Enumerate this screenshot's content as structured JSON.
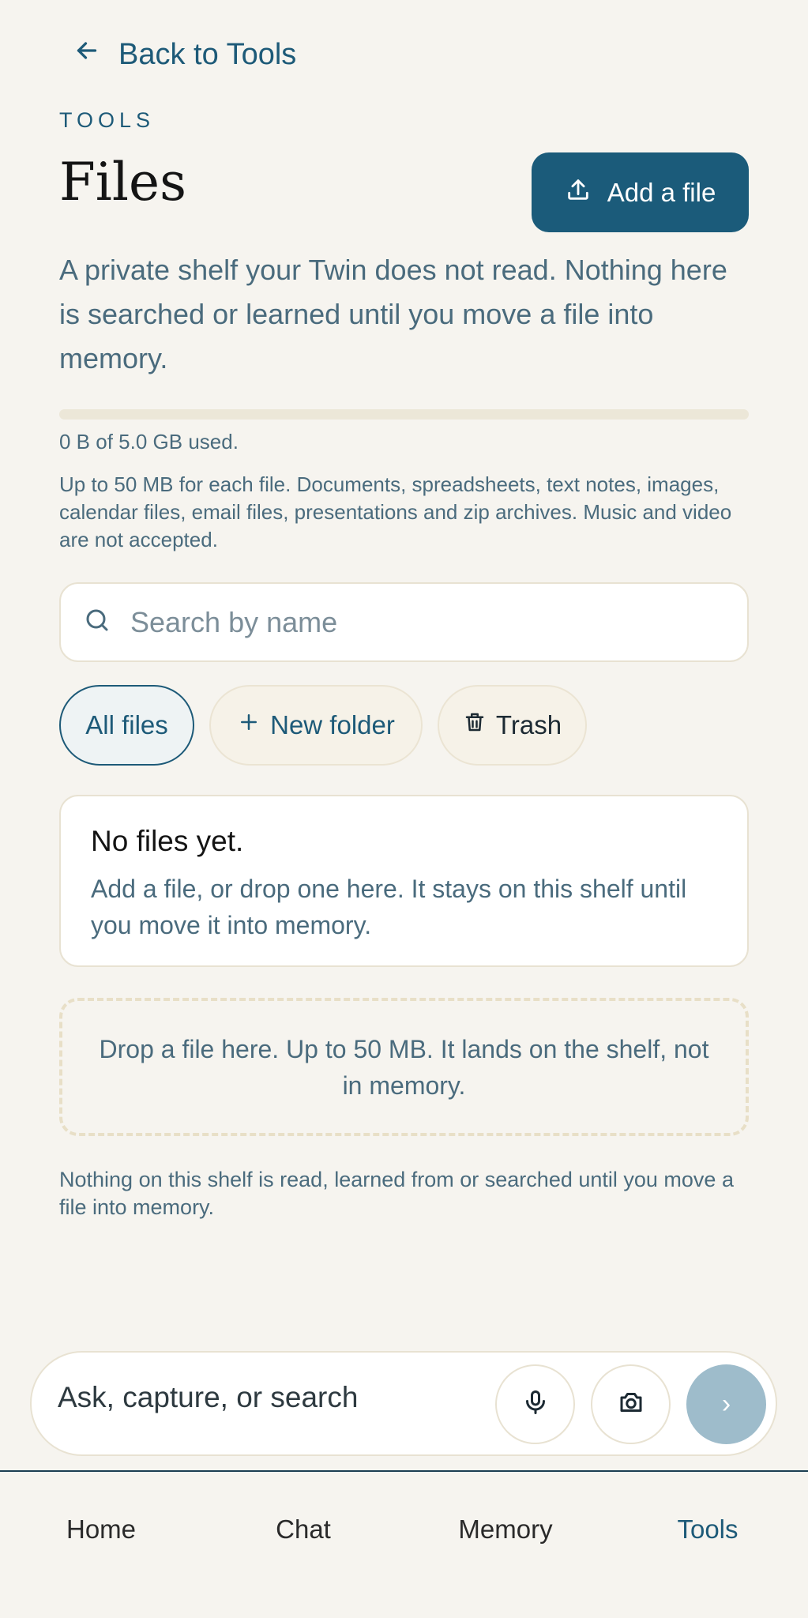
{
  "header": {
    "back_label": "Back to Tools",
    "eyebrow": "TOOLS",
    "title": "Files",
    "add_file_label": "Add a file",
    "intro": "A private shelf your Twin does not read. Nothing here is searched or learned until you move a file into memory."
  },
  "storage": {
    "used_fraction": 0,
    "usage_text": "0 B of 5.0 GB used.",
    "limits_text": "Up to 50 MB for each file. Documents, spreadsheets, text notes, images, calendar files, email files, presentations and zip archives. Music and video are not accepted."
  },
  "search": {
    "placeholder": "Search by name",
    "value": ""
  },
  "filters": {
    "all_files": "All files",
    "new_folder": "New folder",
    "trash": "Trash"
  },
  "empty_state": {
    "title": "No files yet.",
    "body": "Add a file, or drop one here. It stays on this shelf until you move it into memory."
  },
  "dropzone": {
    "text": "Drop a file here. Up to 50 MB. It lands on the shelf, not in memory."
  },
  "footer_note": "Nothing on this shelf is read, learned from or searched until you move a file into memory.",
  "composer": {
    "placeholder": "Ask, capture, or search",
    "value": "",
    "send_glyph": "›"
  },
  "tabs": [
    {
      "label": "Home"
    },
    {
      "label": "Chat"
    },
    {
      "label": "Memory"
    },
    {
      "label": "Tools",
      "active": true
    }
  ],
  "colors": {
    "accent": "#1b5b7a",
    "background": "#f6f4ef",
    "muted_text": "#4a6b7d",
    "send_button": "#9ebccb"
  },
  "icons": {
    "back": "arrow-left-icon",
    "add_file": "upload-icon",
    "search": "search-icon",
    "new_folder": "plus-icon",
    "trash": "trash-icon",
    "mic": "microphone-icon",
    "camera": "camera-icon",
    "send": "chevron-right-icon"
  }
}
